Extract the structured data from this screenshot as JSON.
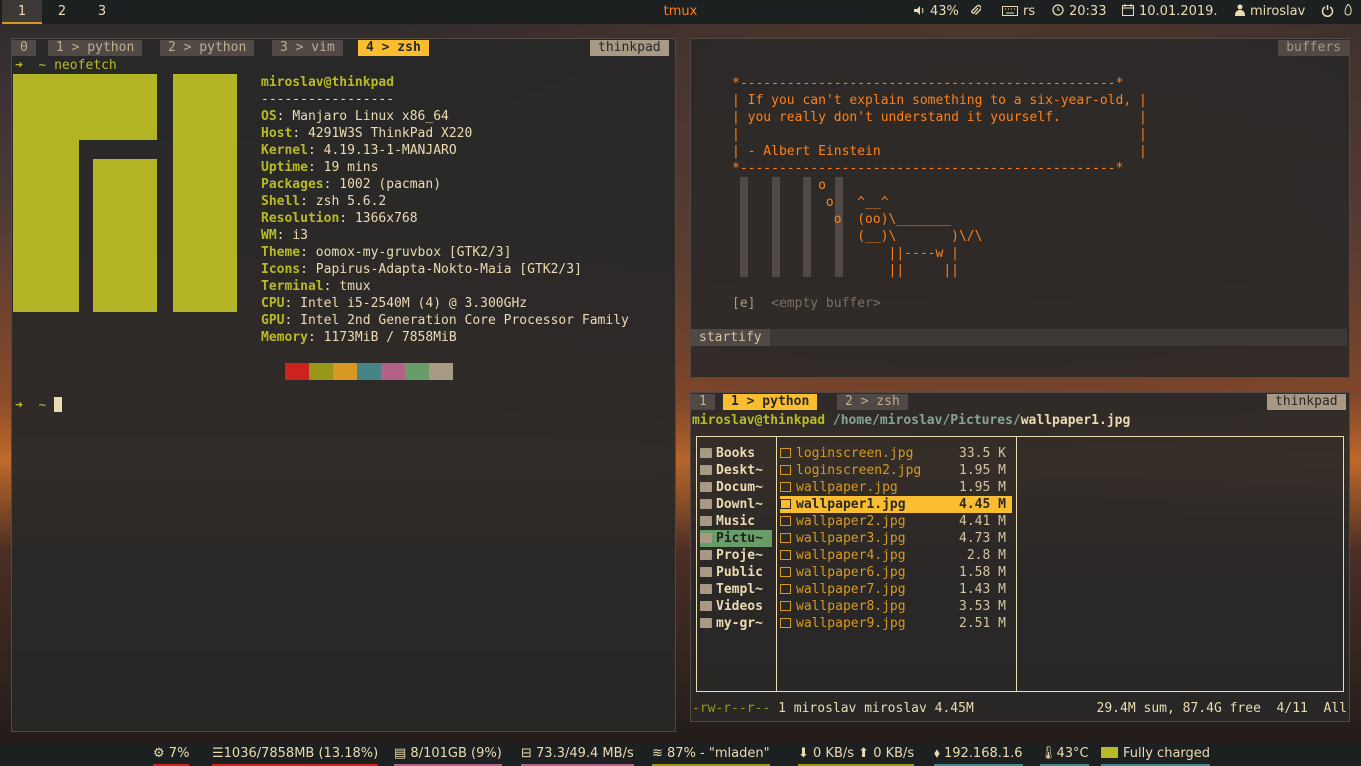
{
  "topbar": {
    "workspaces": [
      "1",
      "2",
      "3"
    ],
    "active_workspace": "1",
    "title": "tmux",
    "volume": "43%",
    "keyboard": "rs",
    "time": "20:33",
    "date": "10.01.2019.",
    "user": "miroslav"
  },
  "left": {
    "tabs": [
      "0",
      "1 > python",
      "2 > python",
      "3 > vim",
      "4 > zsh"
    ],
    "active_tab": "4 > zsh",
    "host": "thinkpad",
    "prompt_cmd": "➜  ~ neofetch",
    "userhost": "miroslav@thinkpad",
    "separator": "-----------------",
    "info": [
      {
        "key": "OS",
        "value": "Manjaro Linux x86_64"
      },
      {
        "key": "Host",
        "value": "4291W3S ThinkPad X220"
      },
      {
        "key": "Kernel",
        "value": "4.19.13-1-MANJARO"
      },
      {
        "key": "Uptime",
        "value": "19 mins"
      },
      {
        "key": "Packages",
        "value": "1002 (pacman)"
      },
      {
        "key": "Shell",
        "value": "zsh 5.6.2"
      },
      {
        "key": "Resolution",
        "value": "1366x768"
      },
      {
        "key": "WM",
        "value": "i3"
      },
      {
        "key": "Theme",
        "value": "oomox-my-gruvbox [GTK2/3]"
      },
      {
        "key": "Icons",
        "value": "Papirus-Adapta-Nokto-Maia [GTK2/3]"
      },
      {
        "key": "Terminal",
        "value": "tmux"
      },
      {
        "key": "CPU",
        "value": "Intel i5-2540M (4) @ 3.300GHz"
      },
      {
        "key": "GPU",
        "value": "Intel 2nd Generation Core Processor Family"
      },
      {
        "key": "Memory",
        "value": "1173MiB / 7858MiB"
      }
    ],
    "palette": [
      "#cc241d",
      "#98971a",
      "#d79921",
      "#458588",
      "#b16286",
      "#689d6a",
      "#a89984"
    ],
    "prompt2": "➜  ~ "
  },
  "right_top": {
    "buffers_label": "buffers",
    "quote": [
      "*------------------------------------------------*",
      "| If you can't explain something to a six-year-old, |",
      "| you really don't understand it yourself.          |",
      "|                                                   |",
      "| - Albert Einstein                                 |",
      "*------------------------------------------------*"
    ],
    "cow": [
      "           o",
      "            o   ^__^",
      "             o  (oo)\\_______",
      "                (__)\\       )\\/\\",
      "                    ||----w |",
      "                    ||     ||"
    ],
    "empty_key": "[e]",
    "empty_label": "<empty buffer>",
    "statusline": "startify"
  },
  "right_bottom": {
    "tabs": [
      "1",
      "1 > python",
      "2 > zsh"
    ],
    "active_tab": "1 > python",
    "host": "thinkpad",
    "userhost": "miroslav@thinkpad",
    "path": "/home/miroslav/Pictures/",
    "current_file": "wallpaper1.jpg",
    "dirs": [
      "Books",
      "Deskt~",
      "Docum~",
      "Downl~",
      "Music",
      "Pictu~",
      "Proje~",
      "Public",
      "Templ~",
      "Videos",
      "my-gr~"
    ],
    "selected_dir": "Pictu~",
    "files": [
      {
        "name": "loginscreen.jpg",
        "size": "33.5 K"
      },
      {
        "name": "loginscreen2.jpg",
        "size": "1.95 M"
      },
      {
        "name": "wallpaper.jpg",
        "size": "1.95 M"
      },
      {
        "name": "wallpaper1.jpg",
        "size": "4.45 M"
      },
      {
        "name": "wallpaper2.jpg",
        "size": "4.41 M"
      },
      {
        "name": "wallpaper3.jpg",
        "size": "4.73 M"
      },
      {
        "name": "wallpaper4.jpg",
        "size": "2.8 M"
      },
      {
        "name": "wallpaper6.jpg",
        "size": "1.58 M"
      },
      {
        "name": "wallpaper7.jpg",
        "size": "1.43 M"
      },
      {
        "name": "wallpaper8.jpg",
        "size": "3.53 M"
      },
      {
        "name": "wallpaper9.jpg",
        "size": "2.51 M"
      }
    ],
    "selected_file": "wallpaper1.jpg",
    "status_perm": "-rw-r--r--",
    "status_info": "1 miroslav miroslav 4.45M",
    "status_right": "29.4M sum, 87.4G free  4/11  All"
  },
  "bottombar": {
    "cpu": "7%",
    "ram": "1036/7858MB (13.18%)",
    "disk": "8/101GB (9%)",
    "net_io": "73.3/49.4 MB/s",
    "wifi": "87% - \"mladen\"",
    "down": "0 KB/s",
    "up": "0 KB/s",
    "ip": "192.168.1.6",
    "temp": "43°C",
    "battery": "Fully charged"
  }
}
